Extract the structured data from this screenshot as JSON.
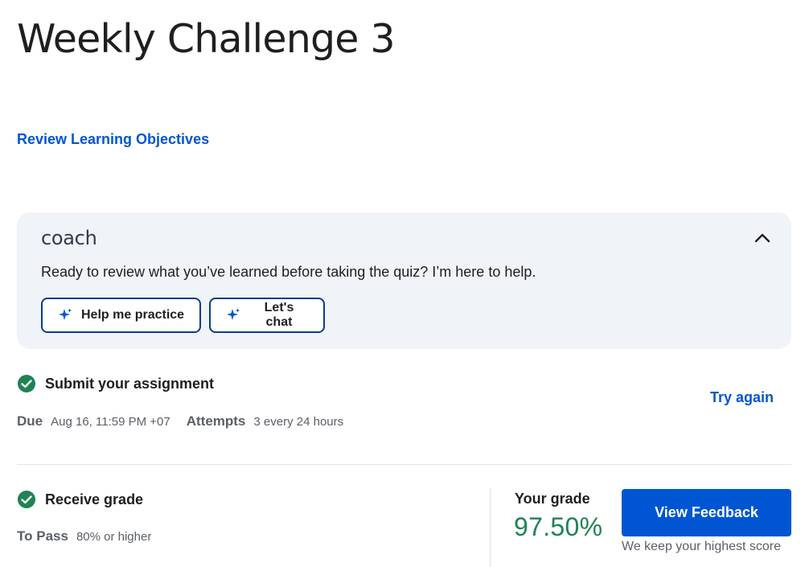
{
  "page": {
    "title": "Weekly Challenge 3",
    "review_link": "Review Learning Objectives"
  },
  "coach": {
    "logo": "coach",
    "message": "Ready to review what you’ve learned before taking the quiz? I’m here to help.",
    "buttons": [
      {
        "label": "Help me practice",
        "icon": "sparkle-icon"
      },
      {
        "label": "Let's chat",
        "icon": "sparkle-icon"
      }
    ],
    "collapse_icon": "chevron-up-icon"
  },
  "submit": {
    "title": "Submit your assignment",
    "status_icon": "check-circle-icon",
    "due_label": "Due",
    "due_value": "Aug 16, 11:59 PM +07",
    "attempts_label": "Attempts",
    "attempts_value": "3 every 24 hours",
    "try_again": "Try again"
  },
  "grade": {
    "title": "Receive grade",
    "status_icon": "check-circle-icon",
    "to_pass_label": "To Pass",
    "to_pass_value": "80% or higher",
    "your_grade_label": "Your grade",
    "your_grade_value": "97.50%",
    "view_feedback": "View Feedback",
    "note": "We keep your highest score"
  },
  "colors": {
    "accent": "#0056d2",
    "success": "#1f8354",
    "panel": "#f0f3f8",
    "button_border": "#0b3a8f"
  }
}
